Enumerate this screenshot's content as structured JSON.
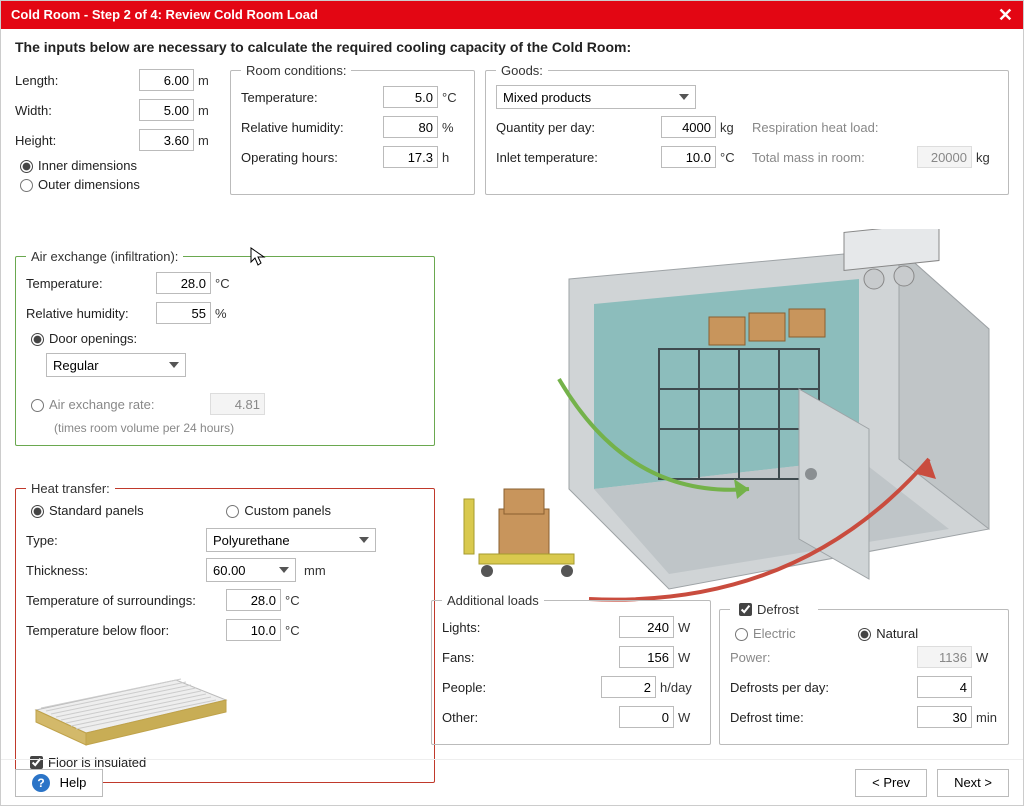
{
  "title": "Cold Room - Step 2 of 4: Review Cold Room Load",
  "subtitle": "The inputs below are necessary to calculate the required cooling capacity of the Cold Room:",
  "dims": {
    "length_label": "Length:",
    "length": "6.00",
    "length_unit": "m",
    "width_label": "Width:",
    "width": "5.00",
    "width_unit": "m",
    "height_label": "Height:",
    "height": "3.60",
    "height_unit": "m",
    "inner_label": "Inner dimensions",
    "outer_label": "Outer dimensions"
  },
  "room": {
    "legend": "Room conditions:",
    "temp_label": "Temperature:",
    "temp": "5.0",
    "temp_unit": "°C",
    "rh_label": "Relative humidity:",
    "rh": "80",
    "rh_unit": "%",
    "hours_label": "Operating hours:",
    "hours": "17.3",
    "hours_unit": "h"
  },
  "goods": {
    "legend": "Goods:",
    "product": "Mixed products",
    "qty_label": "Quantity per day:",
    "qty": "4000",
    "qty_unit": "kg",
    "inlet_label": "Inlet temperature:",
    "inlet": "10.0",
    "inlet_unit": "°C",
    "resp_label": "Respiration heat load:",
    "mass_label": "Total mass in room:",
    "mass": "20000",
    "mass_unit": "kg"
  },
  "air": {
    "legend": "Air exchange (infiltration):",
    "temp_label": "Temperature:",
    "temp": "28.0",
    "temp_unit": "°C",
    "rh_label": "Relative humidity:",
    "rh": "55",
    "rh_unit": "%",
    "door_label": "Door openings:",
    "door_option": "Regular",
    "rate_label": "Air exchange rate:",
    "rate": "4.81",
    "rate_note": "(times room volume per 24 hours)"
  },
  "heat": {
    "legend": "Heat transfer:",
    "std_label": "Standard panels",
    "cust_label": "Custom panels",
    "type_label": "Type:",
    "type_option": "Polyurethane",
    "thick_label": "Thickness:",
    "thick": "60.00",
    "thick_unit": "mm",
    "surr_label": "Temperature of surroundings:",
    "surr": "28.0",
    "surr_unit": "°C",
    "below_label": "Temperature below floor:",
    "below": "10.0",
    "below_unit": "°C",
    "floor_label": "Floor is insulated"
  },
  "add": {
    "legend": "Additional loads",
    "lights_label": "Lights:",
    "lights": "240",
    "lights_unit": "W",
    "fans_label": "Fans:",
    "fans": "156",
    "fans_unit": "W",
    "people_label": "People:",
    "people": "2",
    "people_unit": "h/day",
    "other_label": "Other:",
    "other": "0",
    "other_unit": "W"
  },
  "defrost": {
    "legend": "Defrost",
    "electric_label": "Electric",
    "natural_label": "Natural",
    "power_label": "Power:",
    "power": "1136",
    "power_unit": "W",
    "per_day_label": "Defrosts per day:",
    "per_day": "4",
    "time_label": "Defrost time:",
    "time": "30",
    "time_unit": "min"
  },
  "footer": {
    "help": "Help",
    "prev": "< Prev",
    "next": "Next >"
  }
}
